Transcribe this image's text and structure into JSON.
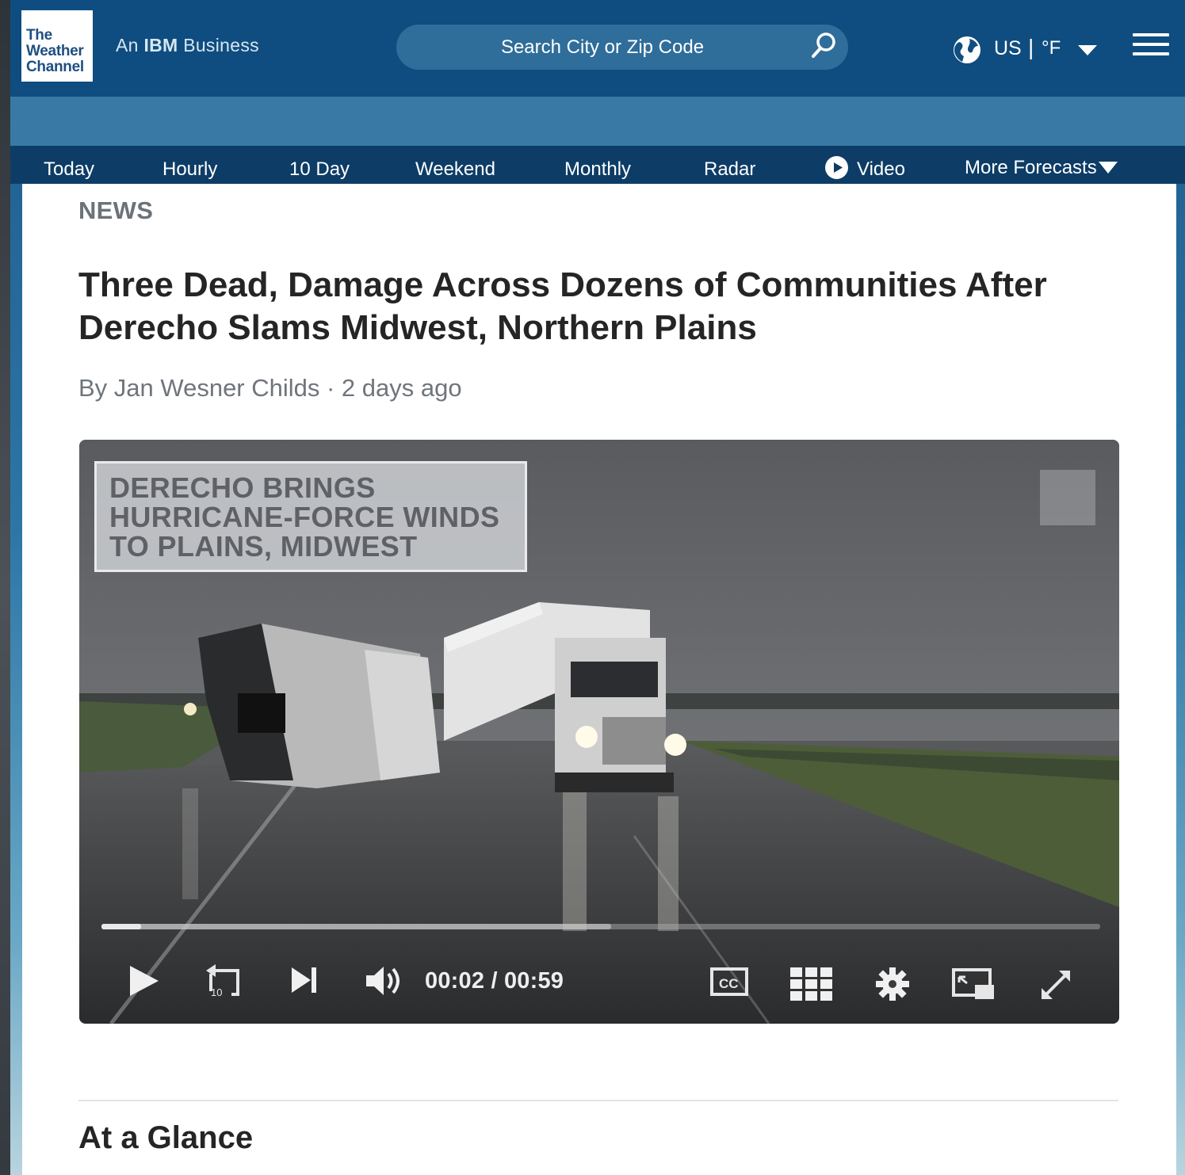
{
  "header": {
    "logo_lines": [
      "The",
      "Weather",
      "Channel"
    ],
    "tagline_prefix": "An ",
    "tagline_brand": "IBM",
    "tagline_suffix": " Business",
    "search": {
      "placeholder": "Search City or Zip Code"
    },
    "locale": "US",
    "separator": "|",
    "unit": "°F",
    "icons": [
      "search-icon",
      "globe-icon",
      "chevron-down-icon",
      "hamburger-menu-icon"
    ]
  },
  "nav": {
    "items": [
      "Today",
      "Hourly",
      "10 Day",
      "Weekend",
      "Monthly",
      "Radar",
      "Video",
      "More Forecasts"
    ]
  },
  "article": {
    "kicker": "NEWS",
    "headline": "Three Dead, Damage Across Dozens of Communities After Derecho Slams Midwest, Northern Plains",
    "byline": "By Jan Wesner Childs · 2 days ago",
    "section_title": "At a Glance"
  },
  "video": {
    "lower_third": [
      "DERECHO BRINGS",
      "HURRICANE-FORCE WINDS",
      "TO PLAINS, MIDWEST"
    ],
    "current_time": "00:02",
    "time_separator": "/",
    "duration": "00:59",
    "progress": 0.04,
    "buffered": 0.51,
    "controls": [
      "play-icon",
      "replay-10-icon",
      "skip-next-icon",
      "volume-icon",
      "closed-captions-icon",
      "playlist-grid-icon",
      "settings-gear-icon",
      "picture-in-picture-icon",
      "fullscreen-icon"
    ]
  },
  "colors": {
    "topbar": "#0f4d80",
    "subbar": "#387aa5",
    "navbar": "#0d3d66",
    "headline": "#252525"
  }
}
